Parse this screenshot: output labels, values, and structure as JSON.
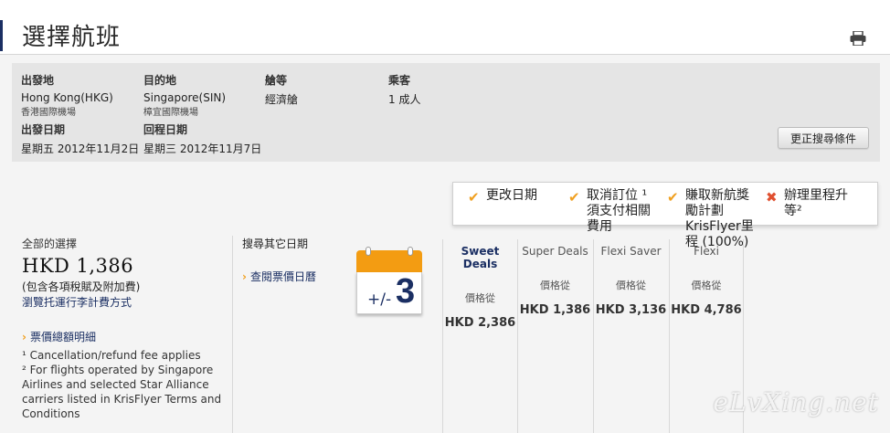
{
  "header": {
    "title": "選擇航班"
  },
  "search": {
    "origin": {
      "label": "出發地",
      "value": "Hong Kong(HKG)",
      "airport": "香港國際機場"
    },
    "destination": {
      "label": "目的地",
      "value": "Singapore(SIN)",
      "airport": "樟宜國際機場"
    },
    "cabin": {
      "label": "艙等",
      "value": "經濟艙"
    },
    "passengers": {
      "label": "乘客",
      "value": "1 成人"
    },
    "depart": {
      "label": "出發日期",
      "value": "星期五 2012年11月2日"
    },
    "return": {
      "label": "回程日期",
      "value": "星期三 2012年11月7日"
    },
    "modify_label": "更正搜尋條件"
  },
  "features": [
    {
      "mark": "✔",
      "type": "check",
      "text": "更改日期"
    },
    {
      "mark": "✔",
      "type": "check",
      "text": "取消訂位 ¹ 須支付相關費用"
    },
    {
      "mark": "✔",
      "type": "check",
      "text": "賺取新航獎勵計劃 KrisFlyer里程 (100%)"
    },
    {
      "mark": "✖",
      "type": "cross",
      "text": "辦理里程升等²"
    }
  ],
  "total": {
    "label": "全部的選擇",
    "price": "HKD 1,386",
    "note": "(包含各項稅賦及附加費)",
    "link": "瀏覽托運行李計費方式"
  },
  "breakdown_label": "票價總額明細",
  "footnotes": [
    "¹ Cancellation/refund fee applies",
    "² For flights operated by Singapore Airlines and selected Star Alliance carriers listed in KrisFlyer Terms and Conditions"
  ],
  "alt_dates": {
    "label": "搜尋其它日期",
    "link": "查閱票價日曆"
  },
  "calendar": {
    "prefix": "+/-",
    "days": "3"
  },
  "fares": [
    {
      "name": "Sweet Deals",
      "from": "價格從",
      "amount": "HKD 2,386"
    },
    {
      "name": "Super Deals",
      "from": "價格從",
      "amount": "HKD 1,386"
    },
    {
      "name": "Flexi Saver",
      "from": "價格從",
      "amount": "HKD 3,136"
    },
    {
      "name": "Flexi",
      "from": "價格從",
      "amount": "HKD 4,786"
    }
  ],
  "watermark": "eLvXing.net"
}
